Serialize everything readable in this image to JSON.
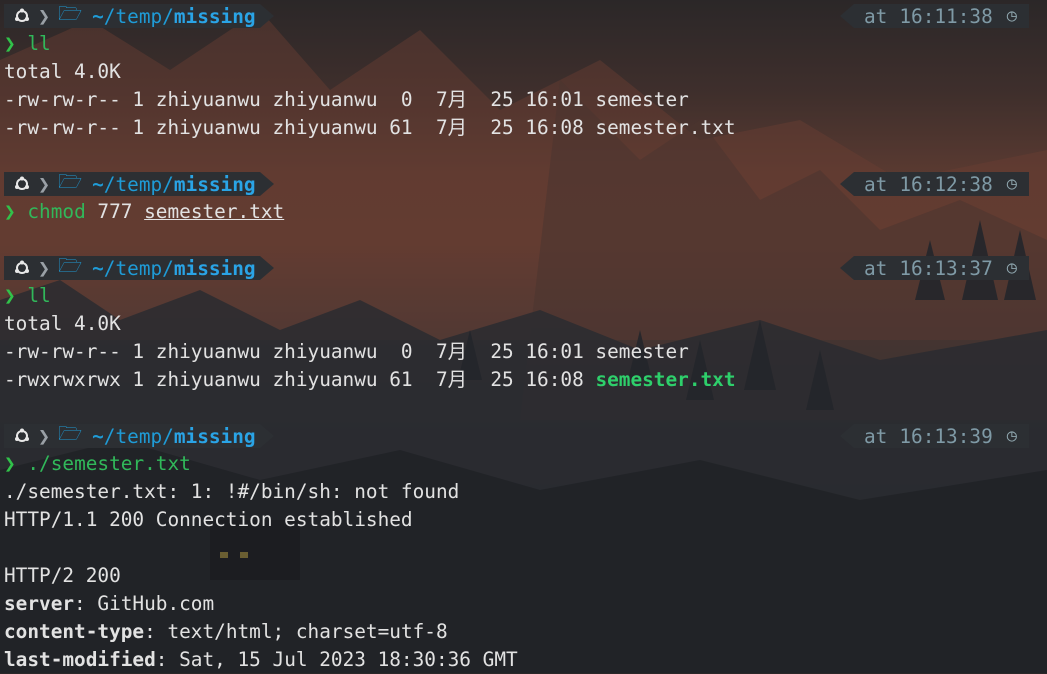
{
  "prompt_blocks": [
    {
      "dir": {
        "home": "~",
        "sep1": "/",
        "temp": "temp",
        "sep2": "/",
        "last": "missing"
      },
      "time": {
        "at": "at",
        "clock": "16:11:38"
      },
      "command": {
        "name": "ll",
        "args": ""
      },
      "output": [
        "total 4.0K",
        "-rw-rw-r-- 1 zhiyuanwu zhiyuanwu  0  7月  25 16:01 semester",
        "-rw-rw-r-- 1 zhiyuanwu zhiyuanwu 61  7月  25 16:08 semester.txt"
      ]
    },
    {
      "dir": {
        "home": "~",
        "sep1": "/",
        "temp": "temp",
        "sep2": "/",
        "last": "missing"
      },
      "time": {
        "at": "at",
        "clock": "16:12:38"
      },
      "command": {
        "name": "chmod",
        "args": " 777 ",
        "file": "semester.txt"
      }
    },
    {
      "dir": {
        "home": "~",
        "sep1": "/",
        "temp": "temp",
        "sep2": "/",
        "last": "missing"
      },
      "time": {
        "at": "at",
        "clock": "16:13:37"
      },
      "command": {
        "name": "ll",
        "args": ""
      },
      "output": [
        "total 4.0K",
        "-rw-rw-r-- 1 zhiyuanwu zhiyuanwu  0  7月  25 16:01 semester",
        "-rwxrwxrwx 1 zhiyuanwu zhiyuanwu 61  7月  25 16:08 "
      ],
      "exe_file": "semester.txt"
    },
    {
      "dir": {
        "home": "~",
        "sep1": "/",
        "temp": "temp",
        "sep2": "/",
        "last": "missing"
      },
      "time": {
        "at": "at",
        "clock": "16:13:39"
      },
      "command": {
        "name": "./semester.txt",
        "args": ""
      },
      "output": [
        "./semester.txt: 1: !#/bin/sh: not found",
        "HTTP/1.1 200 Connection established",
        "",
        "HTTP/2 200"
      ],
      "headers": [
        {
          "key": "server",
          "value": " GitHub.com"
        },
        {
          "key": "content-type",
          "value": " text/html; charset=utf-8"
        },
        {
          "key": "last-modified",
          "value": " Sat, 15 Jul 2023 18:30:36 GMT"
        }
      ]
    }
  ],
  "symbols": {
    "os_icon": "ubuntu-icon",
    "folder_icon": "folder-icon",
    "clock_icon": "clock-icon",
    "prompt_char": "❯",
    "separator": "〉",
    "colon": ":"
  },
  "colors": {
    "prompt_green": "#31c24a",
    "dir_blue": "#1f9bd6",
    "exe_green": "#2ecf6b",
    "segment_bg": "#2c2f33"
  }
}
